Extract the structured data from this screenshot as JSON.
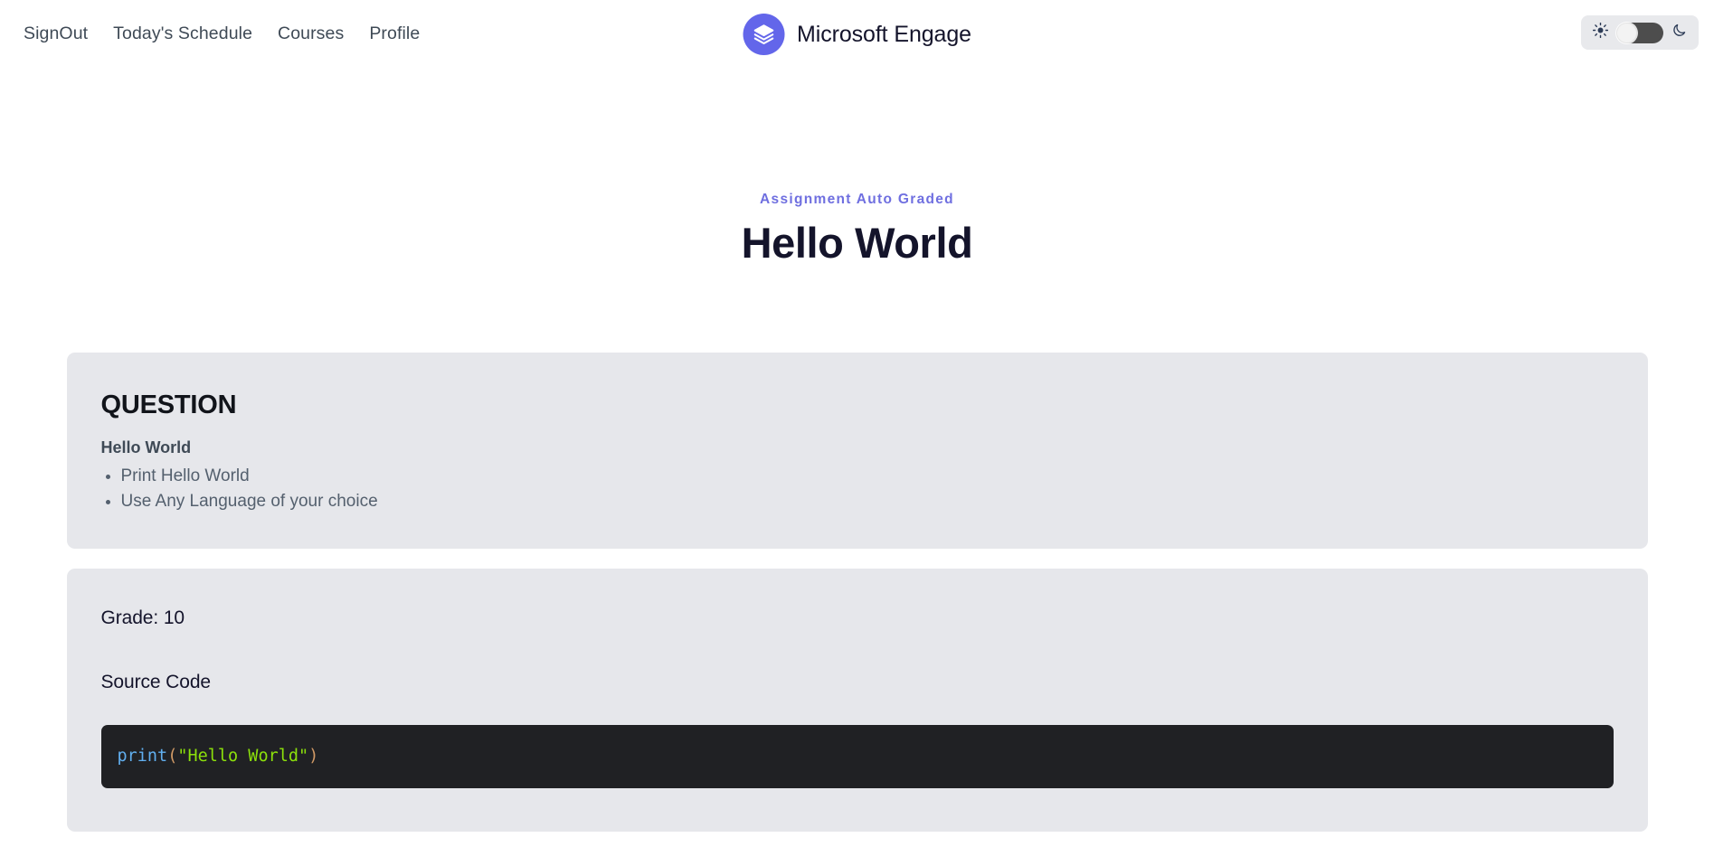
{
  "header": {
    "nav": [
      {
        "label": "SignOut",
        "name": "nav-link-signout"
      },
      {
        "label": "Today's Schedule",
        "name": "nav-link-todays-schedule"
      },
      {
        "label": "Courses",
        "name": "nav-link-courses"
      },
      {
        "label": "Profile",
        "name": "nav-link-profile"
      }
    ],
    "brand_title": "Microsoft Engage",
    "logo_icon": "layers-stack-icon",
    "theme_toggle": {
      "sun_icon": "sun-icon",
      "moon_icon": "moon-icon",
      "state": "light"
    }
  },
  "title_block": {
    "eyebrow": "Assignment Auto Graded",
    "title": "Hello World"
  },
  "question_card": {
    "heading": "QUESTION",
    "subtitle": "Hello World",
    "items": [
      "Print Hello World",
      "Use Any Language of your choice"
    ]
  },
  "answer_card": {
    "grade": "Grade: 10",
    "source_label": "Source Code",
    "code": {
      "fn": "print",
      "open_paren": "(",
      "string": "\"Hello World\"",
      "close_paren": ")"
    }
  },
  "colors": {
    "brand": "#6366ea",
    "eyebrow": "#6f6fe0",
    "card_bg": "#e6e7eb",
    "code_bg": "#202124",
    "code_fn": "#61afef",
    "code_string": "#8ce10b",
    "code_punct": "#d19a66",
    "page_bg": "#ffffff"
  }
}
